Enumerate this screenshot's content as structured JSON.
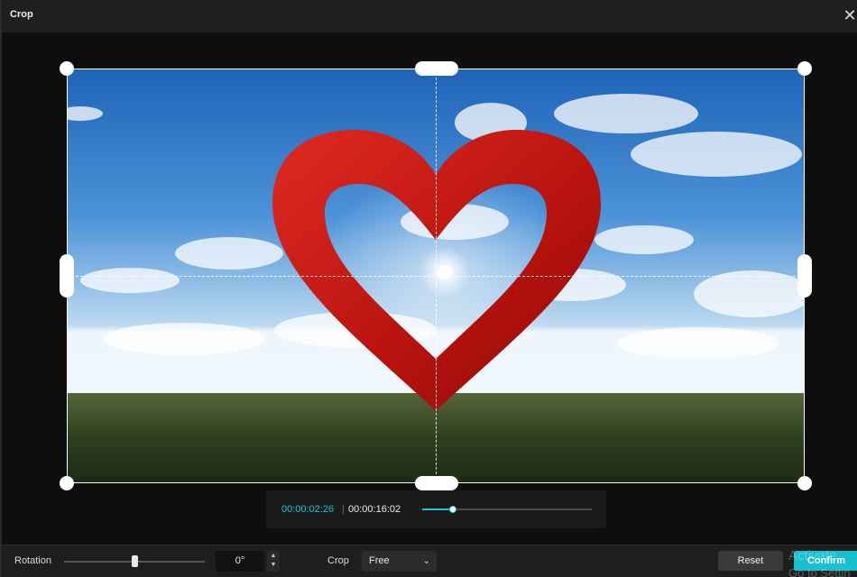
{
  "window": {
    "title": "Crop",
    "close_glyph": "✕",
    "close_icon": "close-icon"
  },
  "playback": {
    "current_time": "00:00:02:26",
    "separator": "|",
    "total_time": "00:00:16:02",
    "progress_fraction": 0.18
  },
  "controls": {
    "rotation_label": "Rotation",
    "rotation_value": "0°",
    "rotation_slider_fraction": 0.5,
    "stepper_up": "▲",
    "stepper_down": "▼",
    "crop_label": "Crop",
    "crop_selected": "Free",
    "crop_chevron": "⌄",
    "reset_label": "Reset",
    "confirm_label": "Confirm"
  },
  "watermark": {
    "line1": "Activate",
    "line2": "Go to Settin"
  },
  "colors": {
    "accent": "#19c6d6",
    "confirm": "#18c1cf",
    "background": "#121212"
  }
}
